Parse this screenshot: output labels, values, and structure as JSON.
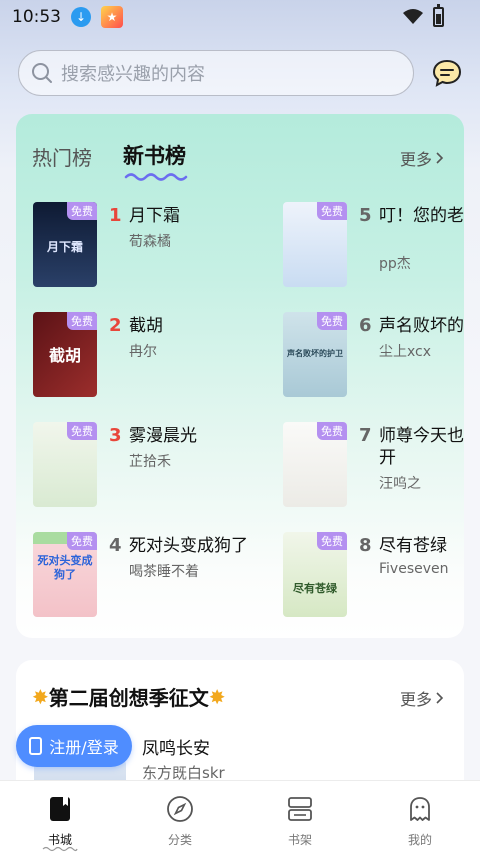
{
  "status_bar": {
    "time": "10:53"
  },
  "search": {
    "placeholder": "搜索感兴趣的内容"
  },
  "ranking": {
    "tabs": [
      {
        "label": "热门榜",
        "active": false
      },
      {
        "label": "新书榜",
        "active": true
      }
    ],
    "more_label": "更多",
    "free_label": "免费",
    "books": [
      {
        "rank": "1",
        "title": "月下霜",
        "author": "荀森橘",
        "cover_text": "月下霜",
        "cover_color": "#1b2b4a"
      },
      {
        "rank": "2",
        "title": "截胡",
        "author": "冉尔",
        "cover_text": "截胡",
        "cover_color": "#7a1f22"
      },
      {
        "rank": "3",
        "title": "雾漫晨光",
        "author": "芷拾禾",
        "cover_text": "",
        "cover_color": "#e6f0df"
      },
      {
        "rank": "4",
        "title": "死对头变成狗了",
        "author": "喝茶睡不着",
        "cover_text": "死对头变成狗了",
        "cover_color": "#f6d6d8"
      },
      {
        "rank": "5",
        "title": "叮！您的老婆已被签收",
        "author": "pp杰",
        "cover_text": "",
        "cover_color": "#dde9f7"
      },
      {
        "rank": "6",
        "title": "声名败坏的护卫",
        "author": "尘上xcx",
        "cover_text": "声名败坏的护卫",
        "cover_color": "#d6e8ef"
      },
      {
        "rank": "7",
        "title": "师尊今天也想让徒儿走开",
        "author": "汪呜之",
        "cover_text": "",
        "cover_color": "#f3f3f1"
      },
      {
        "rank": "8",
        "title": "尽有苍绿",
        "author": "Fiveseven",
        "cover_text": "尽有苍绿",
        "cover_color": "#e9f1e0"
      }
    ]
  },
  "contest": {
    "title": "第二届创想季征文",
    "more_label": "更多",
    "book": {
      "title": "凤鸣长安",
      "author": "东方既白skr"
    }
  },
  "login_button": {
    "label": "注册/登录"
  },
  "bottom_nav": [
    {
      "label": "书城",
      "icon": "book-city-icon",
      "active": true
    },
    {
      "label": "分类",
      "icon": "compass-icon",
      "active": false
    },
    {
      "label": "书架",
      "icon": "bookshelf-icon",
      "active": false
    },
    {
      "label": "我的",
      "icon": "ghost-profile-icon",
      "active": false
    }
  ],
  "colors": {
    "accent": "#4f8dff",
    "rank_top": "#e8463a",
    "free_badge": "#b490f0",
    "tab_wave": "#6b6df0"
  }
}
